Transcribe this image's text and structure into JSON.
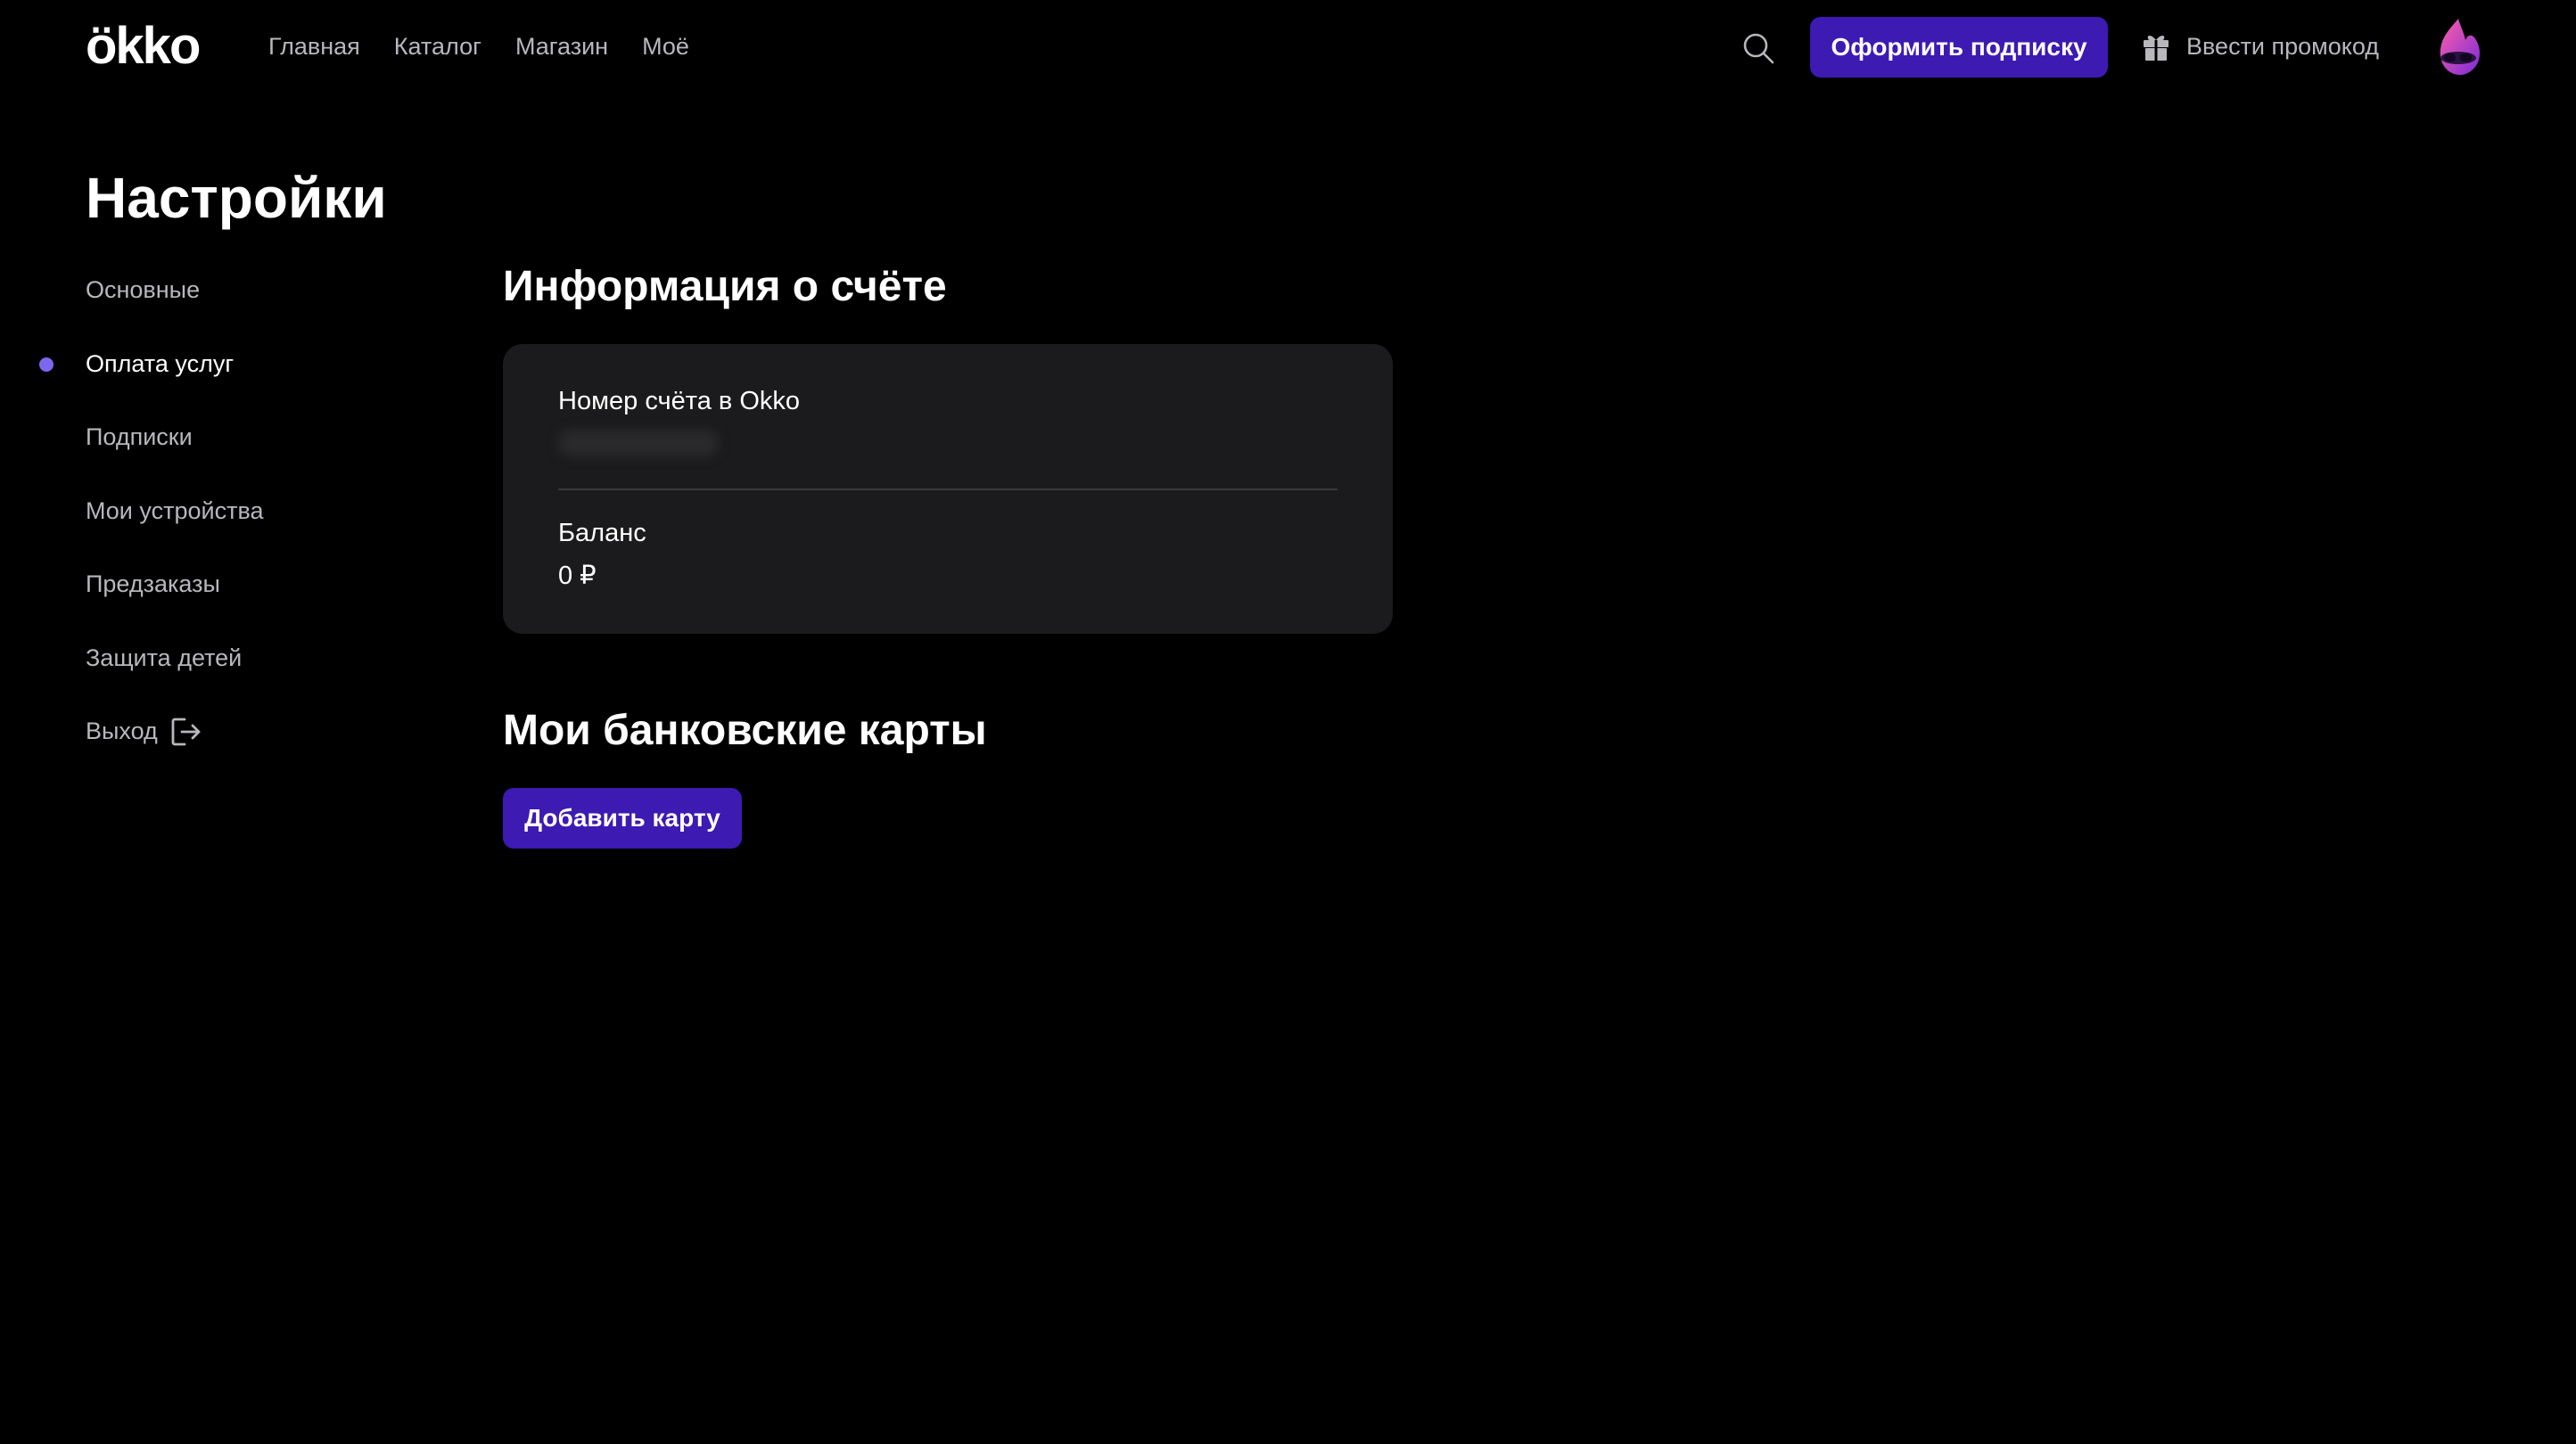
{
  "header": {
    "logo": "ökko",
    "nav": [
      {
        "label": "Главная"
      },
      {
        "label": "Каталог"
      },
      {
        "label": "Магазин"
      },
      {
        "label": "Моё"
      }
    ],
    "search_icon": "search-icon",
    "subscribe_label": "Оформить подписку",
    "promo_icon": "gift-icon",
    "promo_label": "Ввести промокод",
    "avatar": "avatar"
  },
  "page": {
    "title": "Настройки"
  },
  "sidebar": {
    "items": [
      {
        "label": "Основные",
        "active": false
      },
      {
        "label": "Оплата услуг",
        "active": true
      },
      {
        "label": "Подписки",
        "active": false
      },
      {
        "label": "Мои устройства",
        "active": false
      },
      {
        "label": "Предзаказы",
        "active": false
      },
      {
        "label": "Защита детей",
        "active": false
      },
      {
        "label": "Выход",
        "active": false,
        "icon": "exit-icon"
      }
    ]
  },
  "account": {
    "title": "Информация о счёте",
    "number_label": "Номер счёта в Okko",
    "balance_label": "Баланс",
    "balance_value": "0 ₽"
  },
  "cards": {
    "title": "Мои банковские карты",
    "add_label": "Добавить карту"
  },
  "colors": {
    "background": "#000000",
    "accent": "#3d1ab2",
    "active_dot": "#7b68ee",
    "card_background": "#1b1b1d",
    "muted_text": "#b7b7bd"
  }
}
